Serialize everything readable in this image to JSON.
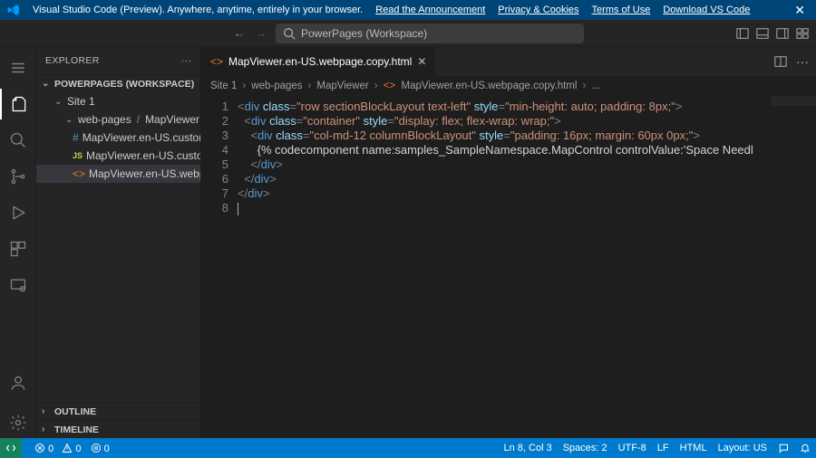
{
  "banner": {
    "product": "Visual Studio Code (Preview). Anywhere, anytime, entirely in your browser.",
    "links": [
      "Read the Announcement",
      "Privacy & Cookies",
      "Terms of Use",
      "Download VS Code"
    ]
  },
  "nav": {
    "search_placeholder": "PowerPages (Workspace)"
  },
  "sidebar": {
    "title": "EXPLORER",
    "sections": {
      "workspace": {
        "label": "POWERPAGES (WORKSPACE)",
        "tree": {
          "root": "Site 1",
          "folder_parent": "web-pages",
          "folder_child": "MapViewer",
          "files": [
            {
              "icon": "css",
              "name": "MapViewer.en-US.customc..."
            },
            {
              "icon": "js",
              "name": "MapViewer.en-US.customj..."
            },
            {
              "icon": "html",
              "name": "MapViewer.en-US.webpag..."
            }
          ]
        }
      },
      "outline": {
        "label": "OUTLINE"
      },
      "timeline": {
        "label": "TIMELINE"
      }
    }
  },
  "editor": {
    "tab": {
      "filename": "MapViewer.en-US.webpage.copy.html"
    },
    "breadcrumbs": [
      "Site 1",
      "web-pages",
      "MapViewer",
      "MapViewer.en-US.webpage.copy.html",
      "..."
    ],
    "line_numbers": [
      "1",
      "2",
      "3",
      "4",
      "5",
      "6",
      "7",
      "8"
    ],
    "code": {
      "l1": {
        "cls": "row sectionBlockLayout text-left",
        "style": "min-height: auto; padding: 8px;"
      },
      "l2": {
        "cls": "container",
        "style": "display: flex; flex-wrap: wrap;"
      },
      "l3": {
        "cls": "col-md-12 columnBlockLayout",
        "style": "padding: 16px; margin: 60px 0px;"
      },
      "l4": "{% codecomponent name:samples_SampleNamespace.MapControl controlValue:'Space Needl"
    }
  },
  "status": {
    "errors": "0",
    "warnings": "0",
    "ports": "0",
    "cursor": "Ln 8, Col 3",
    "spaces": "Spaces: 2",
    "encoding": "UTF-8",
    "eol": "LF",
    "lang": "HTML",
    "layout": "Layout: US"
  }
}
